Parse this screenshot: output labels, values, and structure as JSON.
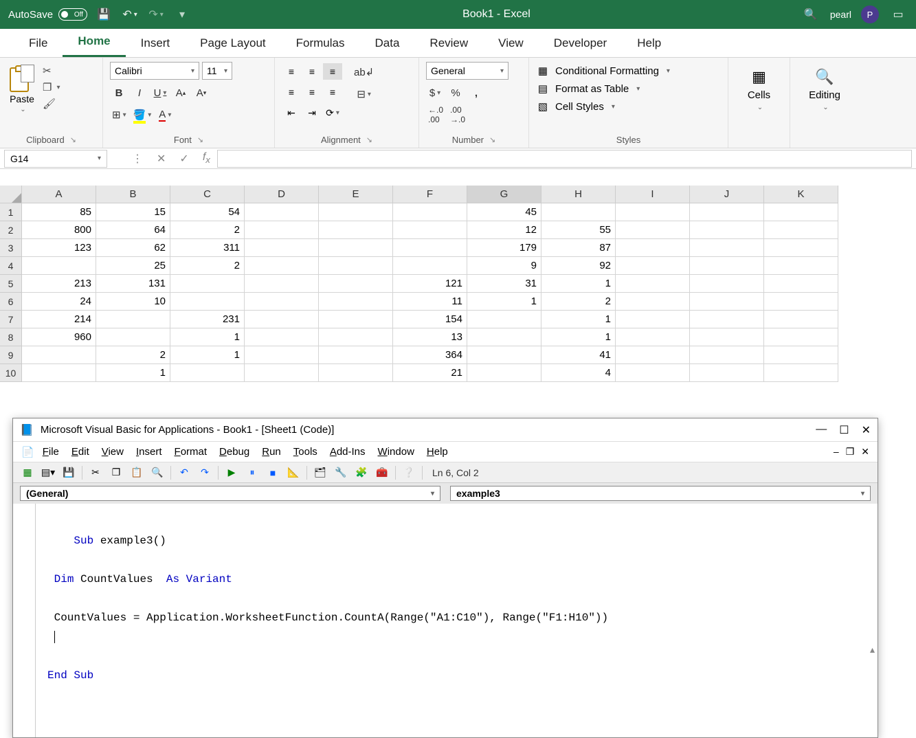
{
  "titlebar": {
    "autosave_label": "AutoSave",
    "autosave_state": "Off",
    "document_title": "Book1 - Excel",
    "user_name": "pearl",
    "user_initial": "P"
  },
  "ribbon_tabs": [
    "File",
    "Home",
    "Insert",
    "Page Layout",
    "Formulas",
    "Data",
    "Review",
    "View",
    "Developer",
    "Help"
  ],
  "active_tab": "Home",
  "ribbon": {
    "clipboard": {
      "label": "Clipboard",
      "paste_label": "Paste"
    },
    "font": {
      "label": "Font",
      "name": "Calibri",
      "size": "11",
      "bold": "B",
      "italic": "I",
      "underline": "U"
    },
    "alignment": {
      "label": "Alignment"
    },
    "number": {
      "label": "Number",
      "format": "General"
    },
    "styles": {
      "label": "Styles",
      "conditional": "Conditional Formatting",
      "table": "Format as Table",
      "cell_styles": "Cell Styles"
    },
    "cells": {
      "label": "Cells"
    },
    "editing": {
      "label": "Editing"
    }
  },
  "namebox": "G14",
  "formula_value": "",
  "columns": [
    "A",
    "B",
    "C",
    "D",
    "E",
    "F",
    "G",
    "H",
    "I",
    "J",
    "K"
  ],
  "selected_col": "G",
  "grid": [
    {
      "A": "85",
      "B": "15",
      "C": "54",
      "D": "",
      "E": "",
      "F": "",
      "G": "45",
      "H": "",
      "I": "",
      "J": "",
      "K": ""
    },
    {
      "A": "800",
      "B": "64",
      "C": "2",
      "D": "",
      "E": "",
      "F": "",
      "G": "12",
      "H": "55",
      "I": "",
      "J": "",
      "K": ""
    },
    {
      "A": "123",
      "B": "62",
      "C": "311",
      "D": "",
      "E": "",
      "F": "",
      "G": "179",
      "H": "87",
      "I": "",
      "J": "",
      "K": ""
    },
    {
      "A": "",
      "B": "25",
      "C": "2",
      "D": "",
      "E": "",
      "F": "",
      "G": "9",
      "H": "92",
      "I": "",
      "J": "",
      "K": ""
    },
    {
      "A": "213",
      "B": "131",
      "C": "",
      "D": "",
      "E": "",
      "F": "121",
      "G": "31",
      "H": "1",
      "I": "",
      "J": "",
      "K": ""
    },
    {
      "A": "24",
      "B": "10",
      "C": "",
      "D": "",
      "E": "",
      "F": "11",
      "G": "1",
      "H": "2",
      "I": "",
      "J": "",
      "K": ""
    },
    {
      "A": "214",
      "B": "",
      "C": "231",
      "D": "",
      "E": "",
      "F": "154",
      "G": "",
      "H": "1",
      "I": "",
      "J": "",
      "K": ""
    },
    {
      "A": "960",
      "B": "",
      "C": "1",
      "D": "",
      "E": "",
      "F": "13",
      "G": "",
      "H": "1",
      "I": "",
      "J": "",
      "K": ""
    },
    {
      "A": "",
      "B": "2",
      "C": "1",
      "D": "",
      "E": "",
      "F": "364",
      "G": "",
      "H": "41",
      "I": "",
      "J": "",
      "K": ""
    },
    {
      "A": "",
      "B": "1",
      "C": "",
      "D": "",
      "E": "",
      "F": "21",
      "G": "",
      "H": "4",
      "I": "",
      "J": "",
      "K": ""
    }
  ],
  "vba": {
    "title": "Microsoft Visual Basic for Applications - Book1 - [Sheet1 (Code)]",
    "menu": [
      "File",
      "Edit",
      "View",
      "Insert",
      "Format",
      "Debug",
      "Run",
      "Tools",
      "Add-Ins",
      "Window",
      "Help"
    ],
    "cursor_pos": "Ln 6, Col 2",
    "left_dd": "(General)",
    "right_dd": "example3",
    "code": {
      "l1": {
        "kw": "Sub",
        "rest": " example3()"
      },
      "l2": {
        "kw1": "Dim",
        "mid": " CountValues  ",
        "kw2": "As Variant"
      },
      "l3": " CountValues = Application.WorksheetFunction.CountA(Range(\"A1:C10\"), Range(\"F1:H10\"))",
      "l4": {
        "kw": "End Sub"
      }
    }
  }
}
